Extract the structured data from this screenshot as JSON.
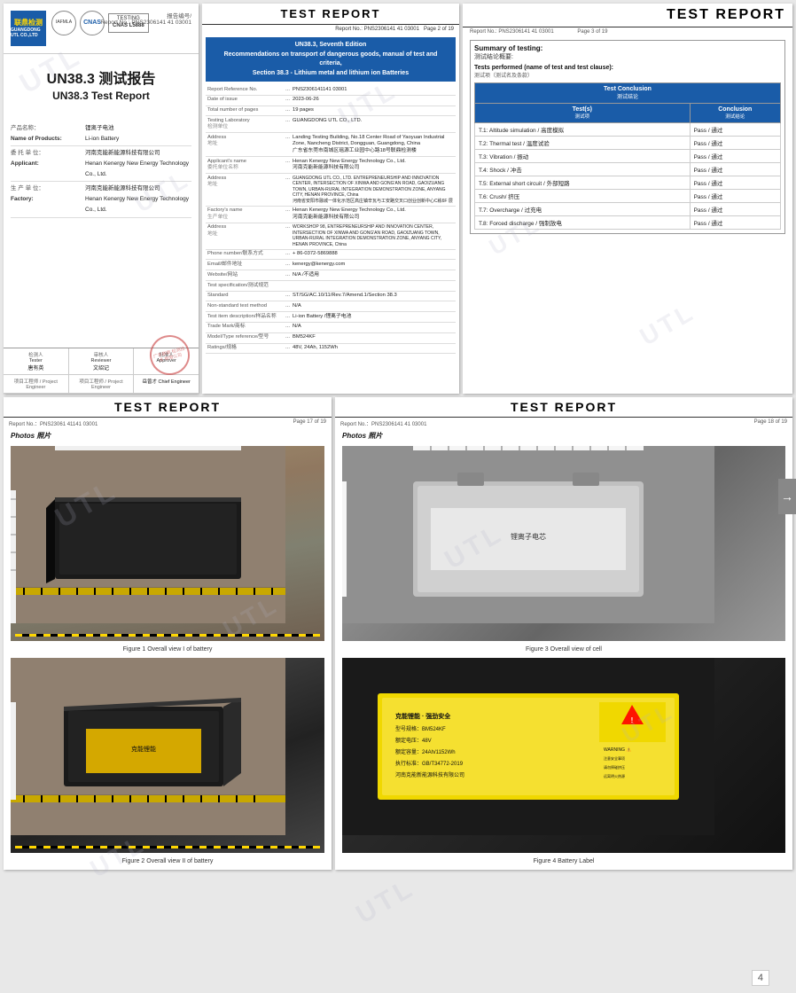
{
  "watermarks": [
    "UTL",
    "UTL",
    "UTL",
    "UTL",
    "UTL",
    "UTL",
    "UTL",
    "UTL"
  ],
  "page1": {
    "logo_text": "联鼎检测",
    "logo_sub": "GUANGDONG UTL CO.,LTD",
    "cert1": "IAF\nMLA",
    "cert2": "CNAS",
    "cnas_label": "TESTING\nCNAS L5888",
    "report_ref_label": "报告编号/",
    "report_ref_en": "Report No.: PNS2306141 41 03001",
    "title_cn": "UN38.3 测试报告",
    "title_en": "UN38.3 Test Report",
    "product_cn": "产品名称：",
    "product_en": "Name of Products:",
    "product_value_cn": "锂离子电池",
    "product_value_en": "Li-ion Battery",
    "applicant_cn": "委 托 单 位：",
    "applicant_en": "Applicant:",
    "applicant_value_cn": "河南克能新能源科技有限公司",
    "applicant_value_en": "Henan Kenergy New Energy Technology Co., Ltd.",
    "factory_cn": "生 产 单 位：",
    "factory_en": "Factory:",
    "factory_value_cn": "河南克能新能源科技有限公司",
    "factory_value_en": "Henan Kenergy New Energy Technology Co., Ltd.",
    "tester_label_cn": "检测人",
    "tester_label_en": "Tester",
    "tester_name": "唐有英",
    "reviewer_label_cn": "审核人",
    "reviewer_label_en": "Reviewer",
    "reviewer_name": "文绍记",
    "approver_label_cn": "批准人",
    "approver_label_en": "Approver",
    "project_eng_cn": "项目工程师 / Project Engineer",
    "project_eng_cn2": "项目工程师 / Project Engineer",
    "project_eng_name": "岳曾才 Chief Engineer",
    "stamp_text": "广东联鼎\n检测技术\n有限公司"
  },
  "page2": {
    "title": "TEST REPORT",
    "report_no": "Report No.: PNS2306141 41 03001",
    "page_no": "Page 2 of 19",
    "blue_box_line1": "UN38.3, Seventh Edition",
    "blue_box_line2": "Recommendations on transport of dangerous goods, manual of test and criteria,",
    "blue_box_line3": "Section 38.3 - Lithium metal and lithium ion Batteries",
    "fields": [
      {
        "label": "Report Reference No.",
        "value": "PNS2306141141 03001"
      },
      {
        "label": "Date of issue",
        "value": "2023-06-26"
      },
      {
        "label": "Total number of pages",
        "value": "19 pages"
      },
      {
        "label": "Testing Laboratory\n检测单位",
        "value": "GUANGDONG UTL CO., LTD."
      },
      {
        "label": "Address\n地址",
        "value": "Landing Testing Building, No.18 Center Road of Yaoyuan Industrial Zone, Nancheng District, Dongguan, Guangdong, China\n广东省东莞市南城区瑶源工业园中心路18号联鼎检测楼"
      },
      {
        "label": "Applicant's name\n委托单位名称",
        "value": "Henan Kenergy New Energy Technology Co., Ltd.\n河南克能新能源科技有限公司"
      },
      {
        "label": "Address\n地址",
        "value": "GUANGDONG UTL CO., LTD. ENTREPRENEURSHIP AND INNOVATION CENTER, INTERSECTION OF XINWA AND GONG'AN ROAD, GAOIZUANG TOWN, URBAN-RURAL INTEGRATION DEMONSTRATION ZONE, ANYANG CITY, HENAN PROVINCE, China\n河南省安阳市融城一体化示范区高庄镇辛瓦与工安路交叉口创业创新中心C栋6F 层"
      },
      {
        "label": "Factory's name\n生产单位",
        "value": "Henan Kenergy New Energy Technology Co., Ltd.\n河南克能新能源科技有限公司"
      },
      {
        "label": "Address\n地址",
        "value": "WORKSHOP 98, ENTREPRENEURSHIP AND INNOVATION CENTER, INTERSECTION OF XINWA AND GONG'AN ROAD, GAOIZUANG TOWN, URBAN-RURAL INTEGRATION DEMONSTRATION ZONE, ANYANG CITY, HENAN PROVINCE, China\n河南省安阳市融城一体化示范区高庄镇辛瓦与工安路交叉口创业创新中心C栋6F 层"
      },
      {
        "label": "Phone number/联系方式",
        "value": "+ 86-0372-5869888"
      },
      {
        "label": "Email/邮件地址",
        "value": "kenergy@kenergy.com"
      },
      {
        "label": "Website/网站",
        "value": "N/A /不适用"
      },
      {
        "label": "Test specification/测试规范",
        "value": ""
      },
      {
        "label": "Standard",
        "value": "ST/SG/AC.10/11/Rev.7/Amend.1/Section 38.3"
      },
      {
        "label": "Non-standard test method",
        "value": "N/A"
      },
      {
        "label": "Test item description/样品名称",
        "value": "Li-ion Battery /锂离子电池"
      },
      {
        "label": "Trade Mark/商标",
        "value": "N/A"
      },
      {
        "label": "Model/Type reference/型号",
        "value": "BM524KF"
      },
      {
        "label": "Ratings/规格",
        "value": "48V, 24Ah,1152Wh"
      }
    ]
  },
  "page3": {
    "title": "TEST REPORT",
    "report_no": "Report No.: PNS2306141 41 03001",
    "page_no": "Page 3 of 19",
    "summary_title_cn": "Summary of testing:",
    "summary_title_en": "测试结论概要:",
    "tests_title_en": "Tests performed (name of test and test clause):",
    "tests_title_cn": "测试项（测试名及条款）",
    "col_test": "Test Conclusion\n测试结论",
    "col_test_en": "Test(s)\n测试项",
    "col_conclusion": "Conclusion\n测试结论",
    "tests": [
      {
        "en": "T.1: Altitude simulation / 高度模拟",
        "cn": "",
        "conclusion": "Pass / 通过"
      },
      {
        "en": "T.2: Thermal test / 温度试验",
        "cn": "",
        "conclusion": "Pass / 通过"
      },
      {
        "en": "T.3: Vibration / 振动",
        "cn": "",
        "conclusion": "Pass / 通过"
      },
      {
        "en": "T.4: Shock / 冲击",
        "cn": "",
        "conclusion": "Pass / 通过"
      },
      {
        "en": "T.5: External short circuit / 外部短路",
        "cn": "",
        "conclusion": "Pass / 通过"
      },
      {
        "en": "T.6: Crush/ 挤压",
        "cn": "",
        "conclusion": "Pass / 通过"
      },
      {
        "en": "T.7: Overcharge / 过充电",
        "cn": "",
        "conclusion": "Pass / 通过"
      },
      {
        "en": "T.8: Forced discharge / 强制放电",
        "cn": "",
        "conclusion": "Pass / 通过"
      }
    ]
  },
  "page_bottom_left": {
    "title": "TEST REPORT",
    "report_no": "Report No.：PNS23061 41141 03001",
    "page_no": "Page 17 of 19",
    "photos_label": "Photos 照片",
    "fig1_caption": "Figure 1 Overall view I of battery",
    "fig2_caption": "Figure 2 Overall view II of battery"
  },
  "page_bottom_right": {
    "title": "TEST REPORT",
    "report_no": "Report No.：PNS2306141 41 03001",
    "page_no": "Page 18 of 19",
    "photos_label": "Photos 照片",
    "fig3_caption": "Figure 3 Overall view of cell",
    "fig4_caption": "Figure 4 Battery Label"
  },
  "arrow_icon": "←",
  "page_num_label": "4"
}
